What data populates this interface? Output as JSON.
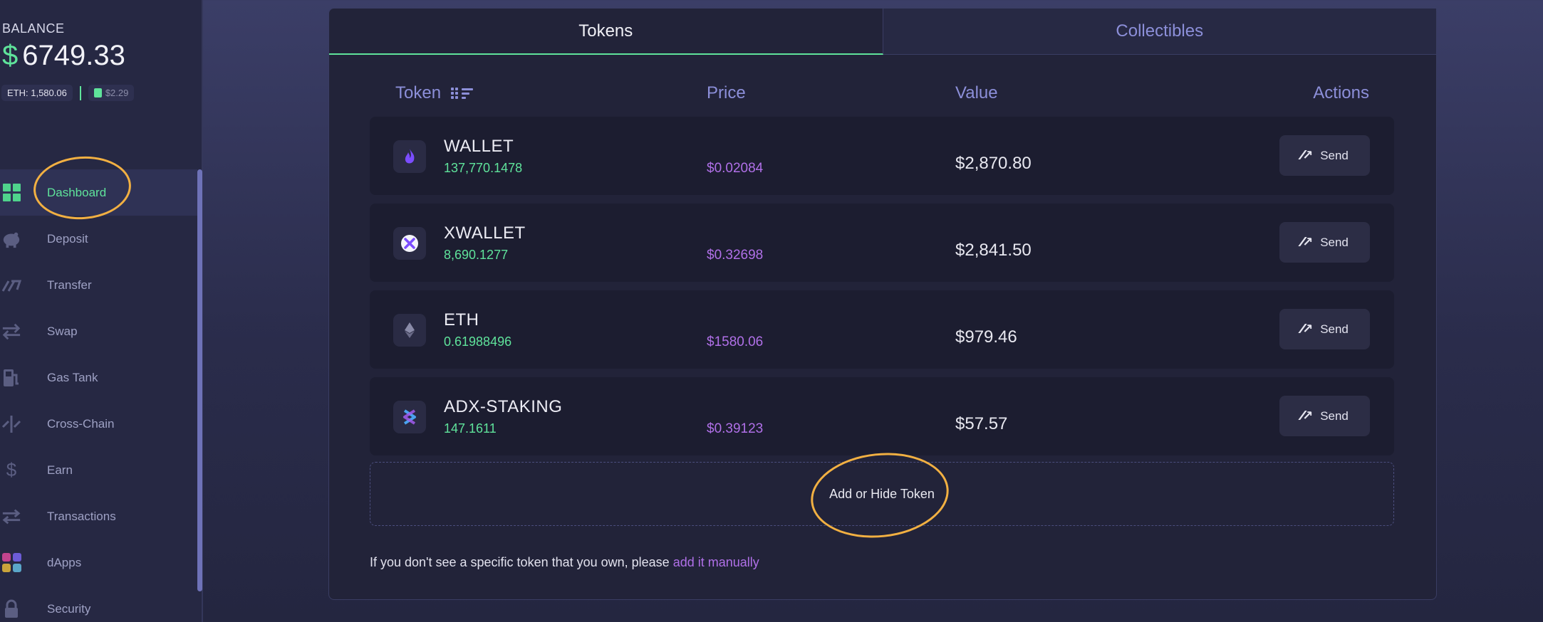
{
  "balance": {
    "label": "BALANCE",
    "currency": "$",
    "amount": "6749.33",
    "eth_price": "ETH: 1,580.06",
    "gas_price": "$2.29"
  },
  "sidebar": {
    "items": [
      {
        "label": "Dashboard",
        "icon": "dashboard-icon",
        "active": true
      },
      {
        "label": "Deposit",
        "icon": "piggy-bank-icon"
      },
      {
        "label": "Transfer",
        "icon": "transfer-icon"
      },
      {
        "label": "Swap",
        "icon": "swap-icon"
      },
      {
        "label": "Gas Tank",
        "icon": "gas-pump-icon"
      },
      {
        "label": "Cross-Chain",
        "icon": "cross-chain-icon"
      },
      {
        "label": "Earn",
        "icon": "dollar-icon"
      },
      {
        "label": "Transactions",
        "icon": "transactions-icon"
      },
      {
        "label": "dApps",
        "icon": "apps-grid-icon"
      },
      {
        "label": "Security",
        "icon": "lock-icon"
      }
    ]
  },
  "tabs": {
    "tokens": "Tokens",
    "collectibles": "Collectibles"
  },
  "table": {
    "headers": {
      "token": "Token",
      "price": "Price",
      "value": "Value",
      "actions": "Actions"
    },
    "rows": [
      {
        "name": "WALLET",
        "balance": "137,770.1478",
        "price": "$0.02084",
        "value": "$2,870.80",
        "action": "Send",
        "icon": "wallet-flame-icon"
      },
      {
        "name": "XWALLET",
        "balance": "8,690.1277",
        "price": "$0.32698",
        "value": "$2,841.50",
        "action": "Send",
        "icon": "xwallet-icon"
      },
      {
        "name": "ETH",
        "balance": "0.61988496",
        "price": "$1580.06",
        "value": "$979.46",
        "action": "Send",
        "icon": "ethereum-icon"
      },
      {
        "name": "ADX-STAKING",
        "balance": "147.1611",
        "price": "$0.39123",
        "value": "$57.57",
        "action": "Send",
        "icon": "adx-icon"
      }
    ]
  },
  "add_token": "Add or Hide Token",
  "footnote": {
    "text": "If you don't see a specific token that you own, please ",
    "link": "add it manually"
  },
  "colors": {
    "accent_green": "#5fe39b",
    "accent_purple": "#b070e8",
    "header_blue": "#8c8fd9",
    "highlight_orange": "#f2b042"
  }
}
